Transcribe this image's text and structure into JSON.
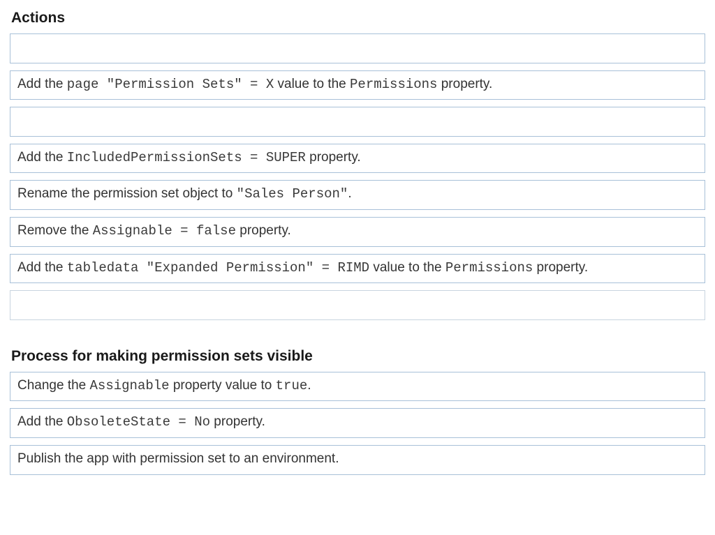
{
  "section1": {
    "heading": "Actions",
    "rows": [
      {
        "kind": "blank"
      },
      {
        "kind": "text",
        "parts": [
          {
            "t": "Add the ",
            "m": false
          },
          {
            "t": "page \"Permission Sets\" = X",
            "m": true
          },
          {
            "t": " value to the ",
            "m": false
          },
          {
            "t": "Permissions",
            "m": true
          },
          {
            "t": " property.",
            "m": false
          }
        ]
      },
      {
        "kind": "blank"
      },
      {
        "kind": "text",
        "parts": [
          {
            "t": "Add the ",
            "m": false
          },
          {
            "t": "IncludedPermissionSets = SUPER",
            "m": true
          },
          {
            "t": " property.",
            "m": false
          }
        ]
      },
      {
        "kind": "text",
        "parts": [
          {
            "t": "Rename the permission set object to ",
            "m": false
          },
          {
            "t": "\"Sales Person\"",
            "m": true
          },
          {
            "t": ".",
            "m": false
          }
        ]
      },
      {
        "kind": "text",
        "parts": [
          {
            "t": "Remove the ",
            "m": false
          },
          {
            "t": "Assignable = false",
            "m": true
          },
          {
            "t": " property.",
            "m": false
          }
        ]
      },
      {
        "kind": "text",
        "parts": [
          {
            "t": "Add the ",
            "m": false
          },
          {
            "t": "tabledata \"Expanded Permission\" = RIMD",
            "m": true
          },
          {
            "t": " value to the ",
            "m": false
          },
          {
            "t": "Permissions",
            "m": true
          },
          {
            "t": " property.",
            "m": false
          }
        ]
      },
      {
        "kind": "blank-short"
      }
    ]
  },
  "section2": {
    "heading": "Process for making permission sets visible",
    "rows": [
      {
        "kind": "text",
        "parts": [
          {
            "t": "Change the ",
            "m": false
          },
          {
            "t": "Assignable",
            "m": true
          },
          {
            "t": " property value to ",
            "m": false
          },
          {
            "t": "true",
            "m": true
          },
          {
            "t": ".",
            "m": false
          }
        ]
      },
      {
        "kind": "text",
        "parts": [
          {
            "t": "Add the ",
            "m": false
          },
          {
            "t": "ObsoleteState = No",
            "m": true
          },
          {
            "t": " property.",
            "m": false
          }
        ]
      },
      {
        "kind": "text",
        "parts": [
          {
            "t": "Publish the app with permission set to an environment.",
            "m": false
          }
        ]
      }
    ]
  }
}
